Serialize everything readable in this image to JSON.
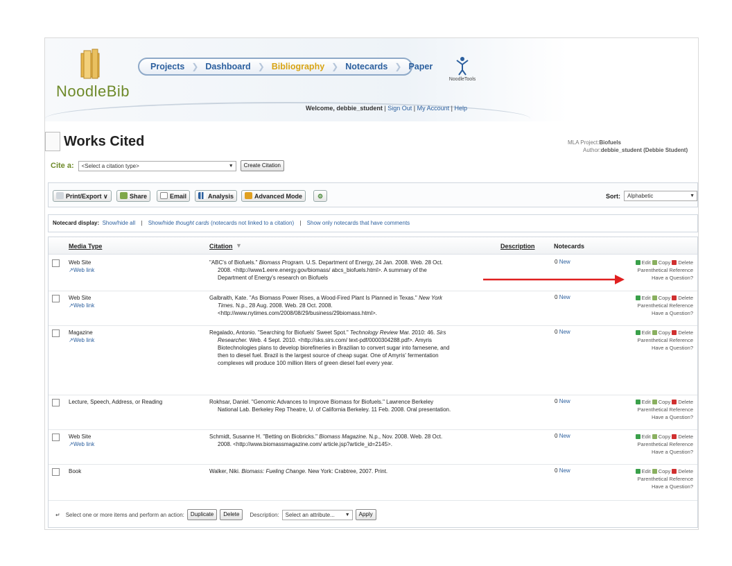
{
  "app": {
    "logo_text": "NoodleBib",
    "brand_text": "NoodleTools"
  },
  "nav": {
    "items": [
      "Projects",
      "Dashboard",
      "Bibliography",
      "Notecards",
      "Paper"
    ],
    "active": "Bibliography"
  },
  "header": {
    "welcome_prefix": "Welcome, ",
    "username": "debbie_student",
    "links": [
      "Sign Out",
      "My Account",
      "Help"
    ]
  },
  "page": {
    "title": "Works Cited"
  },
  "project": {
    "label": "MLA Project:",
    "name": "Biofuels",
    "author_label": "Author:",
    "author": "debbie_student (Debbie Student)"
  },
  "cite": {
    "label": "Cite a:",
    "select_value": "<Select a citation type>",
    "button": "Create Citation"
  },
  "toolbar": {
    "print": "Print/Export",
    "share": "Share",
    "email": "Email",
    "analysis": "Analysis",
    "advanced": "Advanced Mode",
    "sort_label": "Sort:",
    "sort_value": "Alphabetic"
  },
  "notecard_display": {
    "label": "Notecard display:",
    "link1": "Show/hide all",
    "link2_a": "Show/hide ",
    "link2_italic": "thought cards",
    "link2_b": " (notecards not linked to a citation)",
    "link3": "Show only notecards that have comments"
  },
  "table": {
    "headers": {
      "media": "Media Type",
      "citation": "Citation",
      "description": "Description",
      "notecards": "Notecards"
    },
    "rows": [
      {
        "media": "Web Site",
        "web_link": "Web link",
        "citation_html": "\"ABC's of Biofuels.\" <i>Biomass Program.</i> U.S. Department of Energy, 24 Jan. 2008. Web. 28 Oct. 2008. &lt;http://www1.eere.energy.gov/biomass/ abcs_biofuels.html&gt;. A summary of the Department of Energy's research on Biofuels",
        "notecards": "0",
        "new": "New"
      },
      {
        "media": "Web Site",
        "web_link": "Web link",
        "citation_html": "Galbraith, Kate. \"As Biomass Power Rises, a Wood-Fired Plant Is Planned in Texas.\" <i>New York Times.</i> N.p., 28 Aug. 2008. Web. 28 Oct. 2008. &lt;http://www.nytimes.com/2008/08/29/business/29biomass.html&gt;.",
        "notecards": "0",
        "new": "New"
      },
      {
        "media": "Magazine",
        "web_link": "Web link",
        "citation_html": "Regalado, Antonio. \"Searching for Biofuels' Sweet Spot.\" <i>Technology Review</i> Mar. 2010: 46. <i>Sirs Researcher.</i> Web. 4 Sept. 2010. &lt;http://sks.sirs.com/ text-pdf/0000304288.pdf&gt;. Amyris Biotechnologies plans to develop biorefineries in Brazilian to convert sugar into farnesene, and then to diesel fuel. Brazil is the largest source of cheap sugar. One of Amyris' fermentation complexes will produce 100 million liters of green diesel fuel every year.",
        "notecards": "0",
        "new": "New"
      },
      {
        "media": "Lecture, Speech, Address, or Reading",
        "web_link": "",
        "citation_html": "Rokhsar, Daniel. \"Genomic Advances to Improve Biomass for Biofuels.\" Lawrence Berkeley National Lab. Berkeley Rep Theatre, U. of California Berkeley. 11 Feb. 2008. Oral presentation.",
        "notecards": "0",
        "new": "New"
      },
      {
        "media": "Web Site",
        "web_link": "Web link",
        "citation_html": "Schmidt, Susanne H. \"Betting on Biobricks.\" <i>Biomass Magazine.</i> N.p., Nov. 2008. Web. 28 Oct. 2008. &lt;http://www.biomassmagazine.com/ article.jsp?article_id=2145&gt;.",
        "notecards": "0",
        "new": "New"
      },
      {
        "media": "Book",
        "web_link": "",
        "citation_html": "Walker, Niki. <i>Biomass: Fueling Change.</i> New York: Crabtree, 2007. Print.",
        "notecards": "0",
        "new": "New"
      }
    ],
    "row_actions": {
      "edit": "Edit",
      "copy": "Copy",
      "delete": "Delete",
      "parenthetical": "Parenthetical Reference",
      "question": "Have a Question?"
    }
  },
  "footer": {
    "text": "Select one or more items and perform an action:",
    "duplicate": "Duplicate",
    "delete": "Delete",
    "description_label": "Description:",
    "description_select": "Select an attribute...",
    "apply": "Apply"
  },
  "colors": {
    "brand_green": "#6e8a2a",
    "link_blue": "#2b5f9e",
    "active_nav": "#d8a414",
    "arrow_red": "#e02020"
  }
}
